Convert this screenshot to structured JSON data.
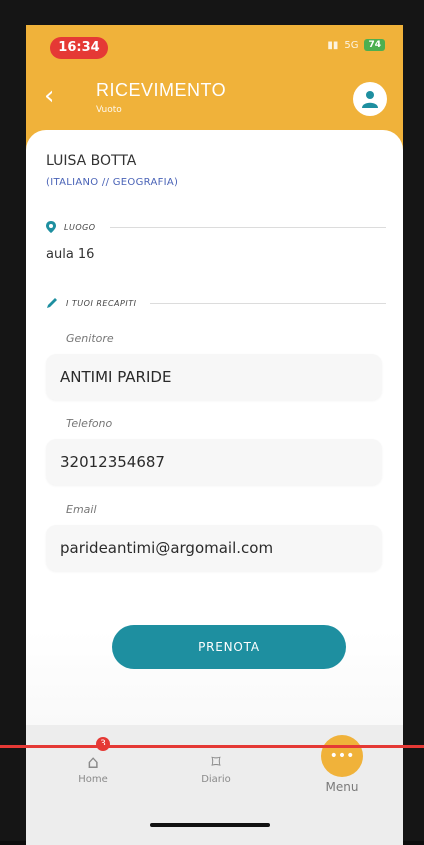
{
  "status": {
    "time": "16:34",
    "network": "5G",
    "battery": "74"
  },
  "header": {
    "title": "RICEVIMENTO",
    "subtitle": "Vuoto"
  },
  "teacher": {
    "name": "LUISA BOTTA",
    "subject": "(ITALIANO // GEOGRAFIA)"
  },
  "luogo": {
    "label": "LUOGO",
    "value": "aula 16"
  },
  "recapiti": {
    "label": "I TUOI RECAPITI",
    "fields": [
      {
        "label": "Genitore",
        "value": "ANTIMI PARIDE"
      },
      {
        "label": "Telefono",
        "value": "32012354687"
      },
      {
        "label": "Email",
        "value": "parideantimi@argomail.com"
      }
    ]
  },
  "action": {
    "label": "PRENOTA"
  },
  "tabs": [
    {
      "label": "Home",
      "icon": "home-icon",
      "badge": "3"
    },
    {
      "label": "Diario",
      "icon": "bookmark-icon"
    },
    {
      "label": "Menu",
      "icon": "menu-icon"
    }
  ],
  "colors": {
    "accent": "#f0b23a",
    "button": "#1e8fa0",
    "badge": "#e53935"
  }
}
